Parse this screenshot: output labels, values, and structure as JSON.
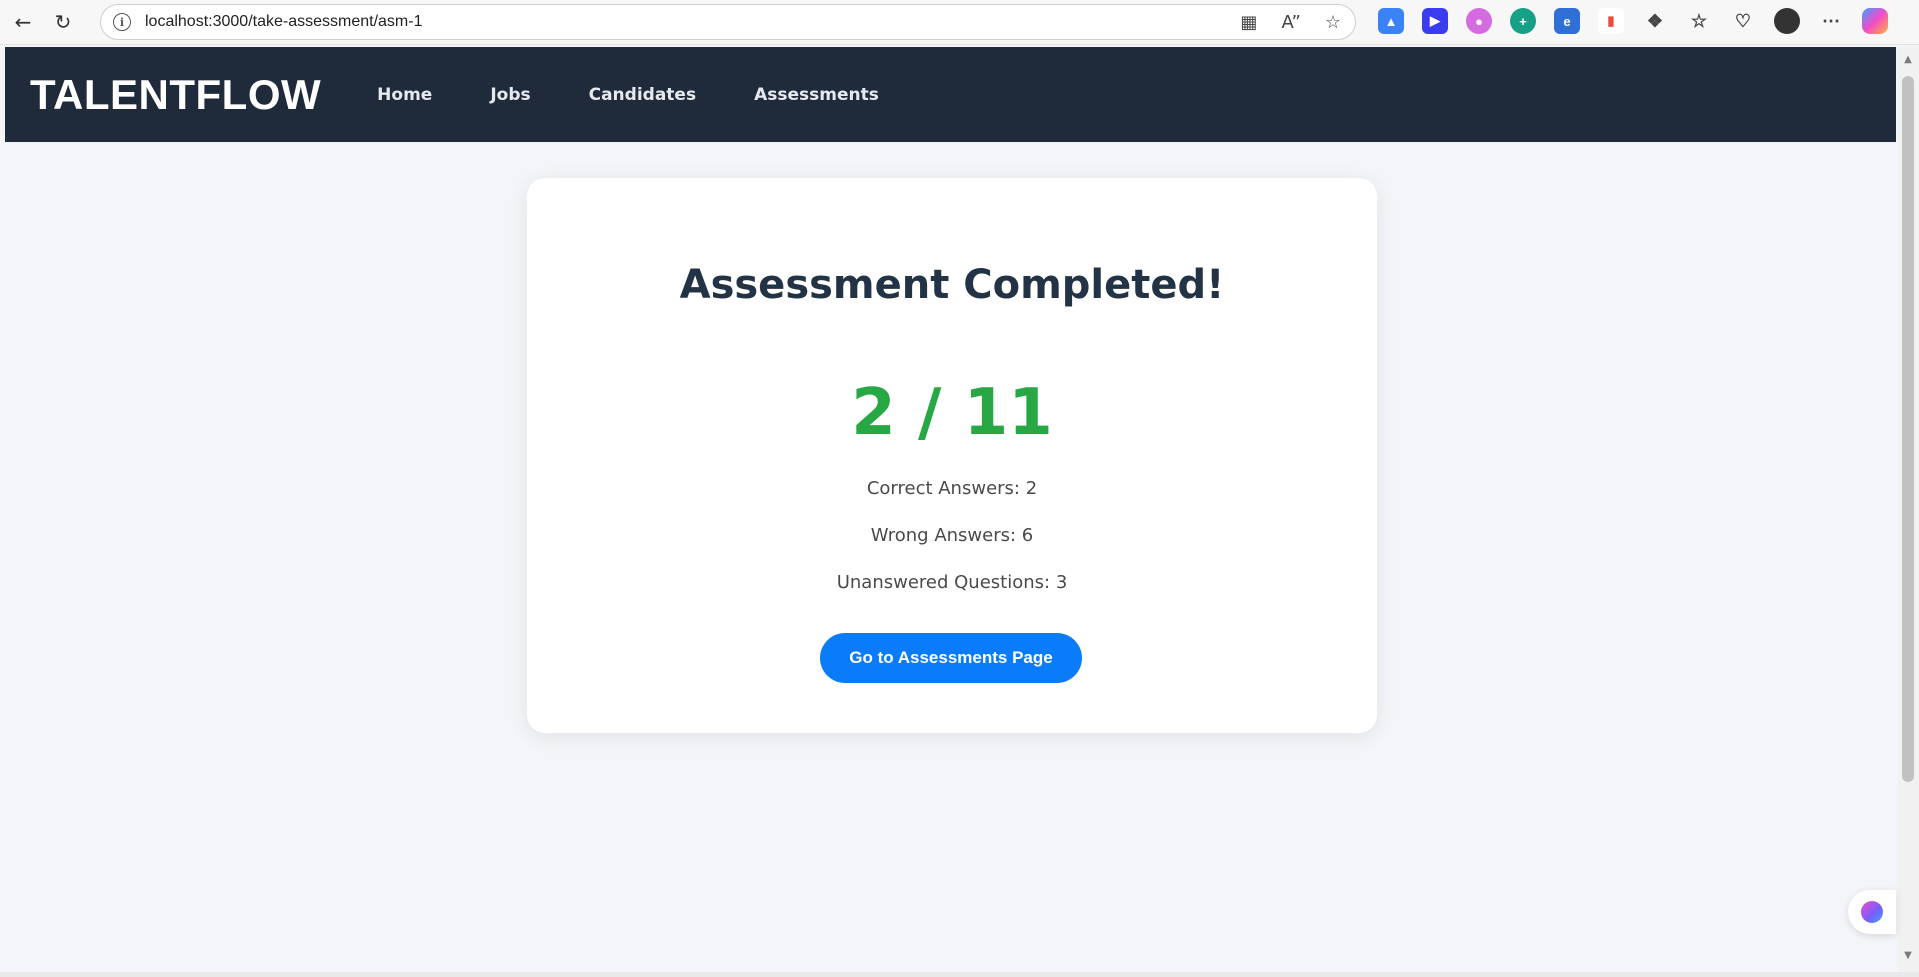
{
  "browser": {
    "url": "localhost:3000/take-assessment/asm-1"
  },
  "navbar": {
    "brand": "TALENTFLOW",
    "links": [
      "Home",
      "Jobs",
      "Candidates",
      "Assessments"
    ]
  },
  "result": {
    "title": "Assessment Completed!",
    "score": "2 / 11",
    "correct": "Correct Answers: 2",
    "wrong": "Wrong Answers: 6",
    "unanswered": "Unanswered Questions: 3",
    "button_label": "Go to Assessments Page"
  },
  "colors": {
    "navbar_bg": "#1f2a3a",
    "score_green": "#27a844",
    "button_blue": "#0a7cf9",
    "page_bg": "#f3f5f8"
  }
}
